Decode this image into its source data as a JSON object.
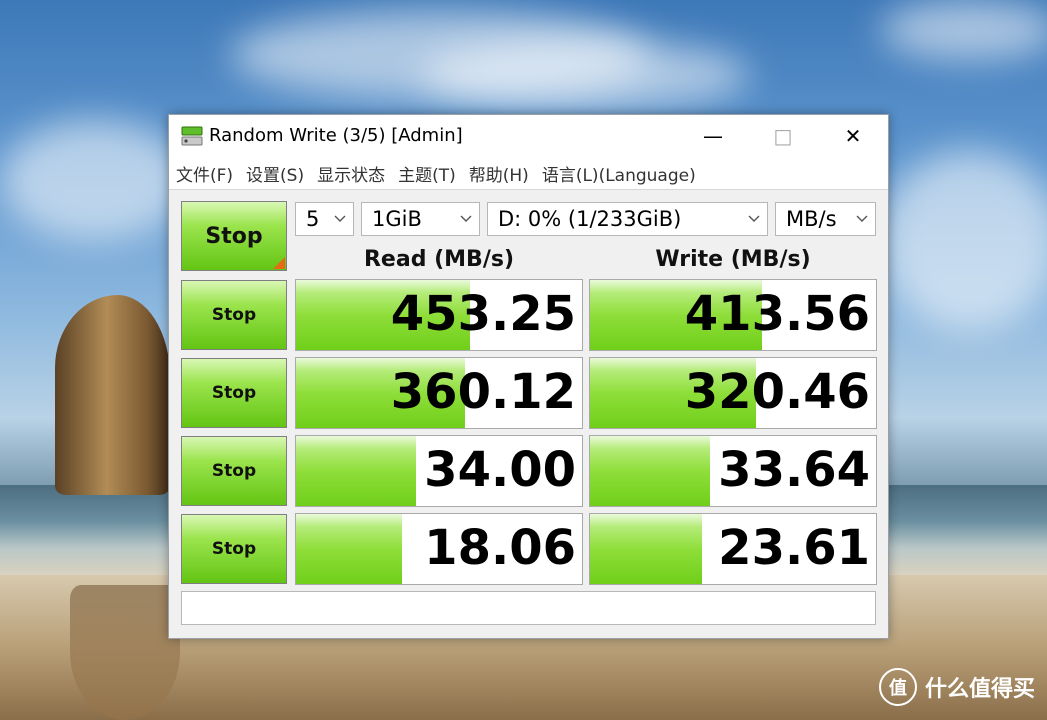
{
  "window": {
    "title": "Random Write (3/5) [Admin]",
    "minimize_symbol": "—",
    "maximize_symbol": "□",
    "close_symbol": "✕"
  },
  "menu": [
    "文件(F)",
    "设置(S)",
    "显示状态",
    "主题(T)",
    "帮助(H)",
    "语言(L)(Language)"
  ],
  "controls": {
    "main_button": "Stop",
    "count": "5",
    "size": "1GiB",
    "drive": "D: 0% (1/233GiB)",
    "unit": "MB/s"
  },
  "headers": {
    "read": "Read (MB/s)",
    "write": "Write (MB/s)"
  },
  "rows": [
    {
      "button": "Stop",
      "read": "453.25",
      "write": "413.56",
      "read_fill": 0.61,
      "write_fill": 0.6
    },
    {
      "button": "Stop",
      "read": "360.12",
      "write": "320.46",
      "read_fill": 0.59,
      "write_fill": 0.58
    },
    {
      "button": "Stop",
      "read": "34.00",
      "write": "33.64",
      "read_fill": 0.42,
      "write_fill": 0.42
    },
    {
      "button": "Stop",
      "read": "18.06",
      "write": "23.61",
      "read_fill": 0.37,
      "write_fill": 0.39
    }
  ],
  "status_text": "",
  "watermark": {
    "logo": "值",
    "text": "什么值得买"
  },
  "colors": {
    "bar_green": "#8fde3a",
    "corner_orange": "#e66a16"
  }
}
